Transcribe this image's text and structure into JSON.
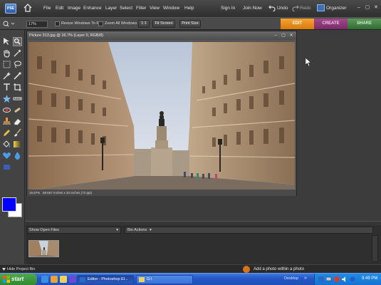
{
  "app": {
    "logo_text": "PSE",
    "menus": [
      "File",
      "Edit",
      "Image",
      "Enhance",
      "Layer",
      "Select",
      "Filter",
      "View",
      "Window",
      "Help"
    ],
    "sign_in": "Sign In",
    "join_now": "Join Now",
    "undo": "Undo",
    "redo": "Redo",
    "organizer": "Organizer"
  },
  "options_bar": {
    "zoom_value": "17%",
    "resize_windows_label": "Resize Windows To Fit",
    "zoom_all_windows_label": "Zoom All Windows",
    "one_to_one_label": "1:1",
    "fit_screen_label": "Fit Screen",
    "print_size_label": "Print Size"
  },
  "mode_tabs": {
    "edit": "EDIT",
    "create": "CREATE",
    "share": "SHARE"
  },
  "colors": {
    "foreground": "#0000ff",
    "background": "#ffffff",
    "edit_tab": "#f08c1a",
    "create_tab": "#8e3a7a",
    "share_tab": "#4a8a4a"
  },
  "document": {
    "title": "Picture 313.jpg @ 16.7% (Layer 0, RGB/8)",
    "zoom_status": "16.67%",
    "size_status": "58.667 Inches x 33 Inches (72 ppi)"
  },
  "project_bin": {
    "show_open_files": "Show Open Files",
    "bin_actions": "Bin Actions",
    "hide_project_bin": "Hide Project Bin"
  },
  "status": {
    "help_text": "Add a photo within a photo"
  },
  "taskbar": {
    "start_label": "start",
    "task_editor": "Editor - Photoshop El...",
    "task_folder": "G:\\",
    "desktop_label": "Desktop",
    "clock": "9:49 PM"
  }
}
